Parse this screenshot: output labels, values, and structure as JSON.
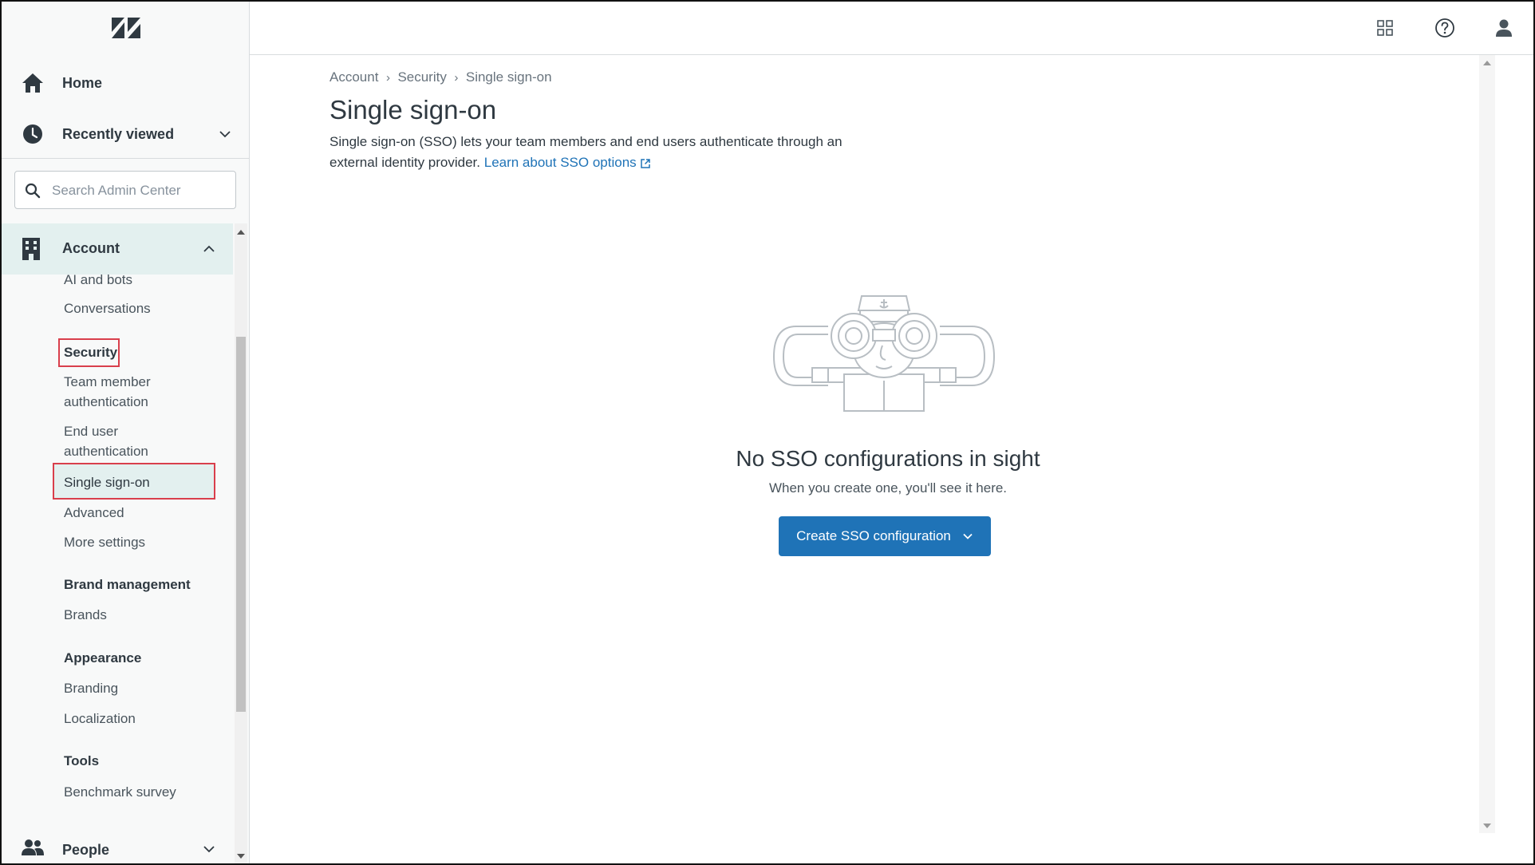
{
  "sidebar": {
    "home_label": "Home",
    "recent_label": "Recently viewed",
    "search_placeholder": "Search Admin Center",
    "account_label": "Account",
    "people_label": "People",
    "items": [
      {
        "label": "AI and bots",
        "type": "sub"
      },
      {
        "label": "Conversations",
        "type": "sub"
      },
      {
        "label": "Security",
        "type": "head"
      },
      {
        "label": "Team member authentication",
        "type": "sub"
      },
      {
        "label": "End user authentication",
        "type": "sub"
      },
      {
        "label": "Single sign-on",
        "type": "active"
      },
      {
        "label": "Advanced",
        "type": "sub"
      },
      {
        "label": "More settings",
        "type": "sub"
      },
      {
        "label": "Brand management",
        "type": "head"
      },
      {
        "label": "Brands",
        "type": "sub"
      },
      {
        "label": "Appearance",
        "type": "head"
      },
      {
        "label": "Branding",
        "type": "sub"
      },
      {
        "label": "Localization",
        "type": "sub"
      },
      {
        "label": "Tools",
        "type": "head"
      },
      {
        "label": "Benchmark survey",
        "type": "sub"
      }
    ],
    "tam_line1": "Team member",
    "tam_line2": "authentication",
    "eua_line1": "End user",
    "eua_line2": "authentication"
  },
  "header": {
    "icons": [
      "apps-grid-icon",
      "help-icon",
      "user-avatar-icon"
    ]
  },
  "main": {
    "breadcrumb": [
      "Account",
      "Security",
      "Single sign-on"
    ],
    "title": "Single sign-on",
    "description": "Single sign-on (SSO) lets your team members and end users authenticate through an external identity provider.",
    "learn_link": "Learn about SSO options",
    "empty_title": "No SSO configurations in sight",
    "empty_subtitle": "When you create one, you'll see it here.",
    "create_button": "Create SSO configuration"
  },
  "colors": {
    "accent": "#1f73b7",
    "active_bg": "#e3f0ef",
    "highlight_border": "#d93f4c"
  }
}
